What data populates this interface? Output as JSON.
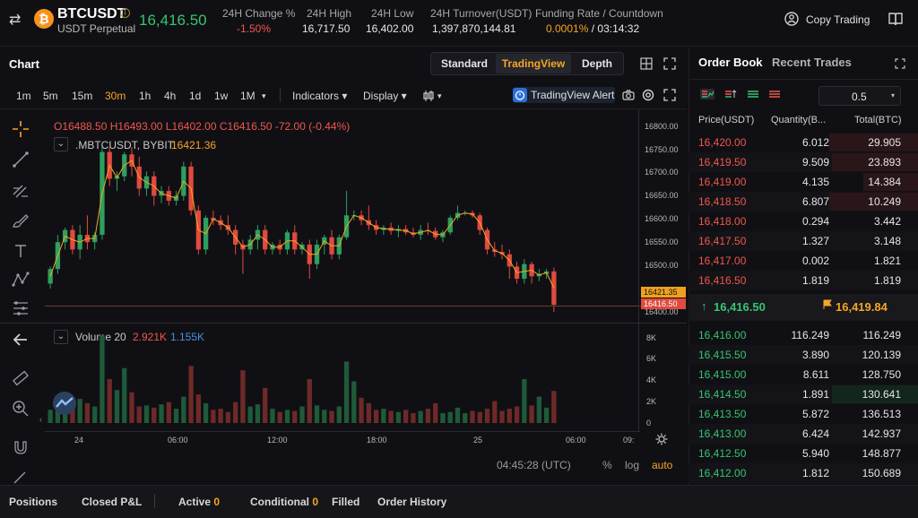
{
  "header": {
    "symbol": "BTCUSDT",
    "info_icon": "i",
    "subtitle": "USDT Perpetual",
    "last_price": "16,416.50",
    "stats": [
      {
        "label": "24H Change %",
        "value": "-1.50%"
      },
      {
        "label": "24H High",
        "value": "16,717.50"
      },
      {
        "label": "24H Low",
        "value": "16,402.00"
      },
      {
        "label": "24H Turnover(USDT)",
        "value": "1,397,870,144.81"
      }
    ],
    "funding_label": "Funding Rate / Countdown",
    "funding_rate": "0.0001%",
    "funding_sep": "/",
    "countdown": "03:14:32",
    "copy_trading": "Copy Trading",
    "coin_glyph": "₿"
  },
  "chart_header": {
    "title": "Chart",
    "views": [
      "Standard",
      "TradingView",
      "Depth"
    ],
    "active_view": "TradingView"
  },
  "toolbar": {
    "timeframes": [
      "1m",
      "5m",
      "15m",
      "30m",
      "1h",
      "4h",
      "1d",
      "1w",
      "1M"
    ],
    "active_timeframe": "30m",
    "timeframe_more": "▾",
    "indicators": "Indicators ▾",
    "display": "Display ▾",
    "chart_type_caret": "▾",
    "tv_alert": "TradingView Alert"
  },
  "legend": {
    "ohlc": "O16488.50  H16493.00  L16402.00  C16416.50  -72.00 (-0.44%)",
    "series_name": ".MBTCUSDT, BYBIT",
    "series_value": "16421.36",
    "volume_name": "Volume 20",
    "volume_v1": "2.921K",
    "volume_v2": "1.155K",
    "collapse_glyph": "⌄"
  },
  "price_axis": {
    "ticks": [
      "16800.00",
      "16750.00",
      "16700.00",
      "16650.00",
      "16600.00",
      "16550.00",
      "16500.00",
      "16400.00"
    ],
    "tag_index": "16421.35",
    "tag_last": "16416.50",
    "volume_ticks": [
      "8K",
      "6K",
      "4K",
      "2K",
      "0"
    ]
  },
  "time_axis": {
    "ticks": [
      "24",
      "06:00",
      "12:00",
      "18:00",
      "25",
      "06:00",
      "09:"
    ]
  },
  "chart_footer": {
    "clock": "04:45:28 (UTC)",
    "percent": "%",
    "log": "log",
    "auto": "auto"
  },
  "chart_data": {
    "type": "candlestick",
    "interval": "30m",
    "symbol": "BTCUSDT",
    "ylim": [
      16380,
      16810
    ],
    "x_ticks": [
      "24",
      "06:00",
      "12:00",
      "18:00",
      "25",
      "06:00",
      "09:"
    ],
    "candles": [
      [
        16460,
        16495,
        16450,
        16490
      ],
      [
        16490,
        16560,
        16480,
        16545
      ],
      [
        16545,
        16575,
        16530,
        16570
      ],
      [
        16570,
        16580,
        16520,
        16530
      ],
      [
        16530,
        16580,
        16510,
        16560
      ],
      [
        16560,
        16600,
        16530,
        16545
      ],
      [
        16545,
        16565,
        16530,
        16560
      ],
      [
        16560,
        16740,
        16550,
        16730
      ],
      [
        16730,
        16740,
        16660,
        16675
      ],
      [
        16675,
        16690,
        16650,
        16680
      ],
      [
        16680,
        16730,
        16670,
        16725
      ],
      [
        16725,
        16740,
        16680,
        16700
      ],
      [
        16700,
        16720,
        16640,
        16655
      ],
      [
        16655,
        16690,
        16640,
        16680
      ],
      [
        16680,
        16690,
        16620,
        16640
      ],
      [
        16640,
        16660,
        16625,
        16650
      ],
      [
        16650,
        16660,
        16620,
        16630
      ],
      [
        16630,
        16650,
        16620,
        16640
      ],
      [
        16640,
        16710,
        16630,
        16700
      ],
      [
        16700,
        16710,
        16600,
        16610
      ],
      [
        16610,
        16620,
        16520,
        16530
      ],
      [
        16530,
        16600,
        16520,
        16595
      ],
      [
        16595,
        16610,
        16580,
        16590
      ],
      [
        16590,
        16600,
        16570,
        16580
      ],
      [
        16580,
        16600,
        16560,
        16570
      ],
      [
        16570,
        16580,
        16520,
        16540
      ],
      [
        16540,
        16550,
        16480,
        16530
      ],
      [
        16530,
        16560,
        16520,
        16550
      ],
      [
        16550,
        16580,
        16530,
        16570
      ],
      [
        16570,
        16580,
        16520,
        16530
      ],
      [
        16530,
        16545,
        16520,
        16540
      ],
      [
        16540,
        16550,
        16520,
        16530
      ],
      [
        16530,
        16570,
        16520,
        16565
      ],
      [
        16565,
        16580,
        16520,
        16530
      ],
      [
        16530,
        16545,
        16520,
        16540
      ],
      [
        16540,
        16550,
        16470,
        16500
      ],
      [
        16500,
        16550,
        16490,
        16540
      ],
      [
        16540,
        16560,
        16520,
        16555
      ],
      [
        16555,
        16570,
        16510,
        16520
      ],
      [
        16520,
        16560,
        16510,
        16555
      ],
      [
        16555,
        16650,
        16550,
        16600
      ],
      [
        16600,
        16610,
        16590,
        16600
      ],
      [
        16600,
        16610,
        16580,
        16590
      ],
      [
        16590,
        16620,
        16570,
        16580
      ],
      [
        16580,
        16590,
        16560,
        16570
      ],
      [
        16570,
        16580,
        16560,
        16575
      ],
      [
        16575,
        16585,
        16560,
        16568
      ],
      [
        16568,
        16580,
        16555,
        16572
      ],
      [
        16572,
        16580,
        16560,
        16565
      ],
      [
        16565,
        16575,
        16555,
        16560
      ],
      [
        16560,
        16580,
        16550,
        16570
      ],
      [
        16570,
        16585,
        16560,
        16568
      ],
      [
        16568,
        16575,
        16550,
        16555
      ],
      [
        16555,
        16570,
        16545,
        16565
      ],
      [
        16565,
        16600,
        16560,
        16595
      ],
      [
        16595,
        16620,
        16590,
        16605
      ],
      [
        16605,
        16610,
        16600,
        16605
      ],
      [
        16605,
        16610,
        16595,
        16600
      ],
      [
        16600,
        16605,
        16560,
        16570
      ],
      [
        16570,
        16575,
        16520,
        16530
      ],
      [
        16530,
        16545,
        16515,
        16525
      ],
      [
        16525,
        16540,
        16510,
        16520
      ],
      [
        16520,
        16530,
        16470,
        16495
      ],
      [
        16495,
        16505,
        16460,
        16470
      ],
      [
        16470,
        16510,
        16460,
        16500
      ],
      [
        16500,
        16505,
        16460,
        16475
      ],
      [
        16475,
        16490,
        16465,
        16480
      ],
      [
        16480,
        16490,
        16470,
        16485
      ],
      [
        16485,
        16493,
        16402,
        16416.5
      ]
    ],
    "volume_ylim": [
      0,
      8000
    ],
    "volumes": [
      1200,
      2500,
      2000,
      1600,
      2200,
      1800,
      1500,
      8000,
      4000,
      3000,
      5000,
      2800,
      1500,
      1600,
      1400,
      1700,
      1900,
      1300,
      2400,
      5200,
      2600,
      1800,
      1200,
      1300,
      1000,
      1900,
      4800,
      1500,
      1700,
      3200,
      1300,
      1000,
      1200,
      1100,
      1500,
      4000,
      1600,
      1200,
      1100,
      1500,
      5600,
      3800,
      2300,
      1800,
      1200,
      1300,
      1100,
      1000,
      1200,
      900,
      1100,
      1300,
      1800,
      900,
      1000,
      1400,
      900,
      1100,
      1000,
      1300,
      2000,
      1100,
      1300,
      1500,
      4000,
      1600,
      2400,
      1400,
      2921
    ]
  },
  "order_book": {
    "tabs": [
      "Order Book",
      "Recent Trades"
    ],
    "active_tab": "Order Book",
    "precision": "0.5",
    "precision_caret": "▾",
    "columns": [
      "Price(USDT)",
      "Quantity(B...",
      "Total(BTC)"
    ],
    "asks": [
      {
        "price": "16,420.00",
        "qty": "6.012",
        "total": "29.905",
        "depth": 0.62
      },
      {
        "price": "16,419.50",
        "qty": "9.509",
        "total": "23.893",
        "depth": 0.6
      },
      {
        "price": "16,419.00",
        "qty": "4.135",
        "total": "14.384",
        "depth": 0.38
      },
      {
        "price": "16,418.50",
        "qty": "6.807",
        "total": "10.249",
        "depth": 0.62
      },
      {
        "price": "16,418.00",
        "qty": "0.294",
        "total": "3.442",
        "depth": 0.0
      },
      {
        "price": "16,417.50",
        "qty": "1.327",
        "total": "3.148",
        "depth": 0.0
      },
      {
        "price": "16,417.00",
        "qty": "0.002",
        "total": "1.821",
        "depth": 0.0
      },
      {
        "price": "16,416.50",
        "qty": "1.819",
        "total": "1.819",
        "depth": 0.0
      }
    ],
    "mid_arrow": "↑",
    "mid_last": "16,416.50",
    "mid_mark": "16,419.84",
    "bids": [
      {
        "price": "16,416.00",
        "qty": "116.249",
        "total": "116.249",
        "depth": 0.0
      },
      {
        "price": "16,415.50",
        "qty": "3.890",
        "total": "120.139",
        "depth": 0.0
      },
      {
        "price": "16,415.00",
        "qty": "8.611",
        "total": "128.750",
        "depth": 0.0
      },
      {
        "price": "16,414.50",
        "qty": "1.891",
        "total": "130.641",
        "depth": 0.6
      },
      {
        "price": "16,413.50",
        "qty": "5.872",
        "total": "136.513",
        "depth": 0.0
      },
      {
        "price": "16,413.00",
        "qty": "6.424",
        "total": "142.937",
        "depth": 0.0
      },
      {
        "price": "16,412.50",
        "qty": "5.940",
        "total": "148.877",
        "depth": 0.0
      },
      {
        "price": "16,412.00",
        "qty": "1.812",
        "total": "150.689",
        "depth": 0.0
      }
    ]
  },
  "bottom_tabs": [
    {
      "label": "Positions",
      "count": ""
    },
    {
      "label": "Closed P&L",
      "count": ""
    },
    {
      "label": "Active",
      "count": "0"
    },
    {
      "label": "Conditional",
      "count": "0"
    },
    {
      "label": "Filled",
      "count": ""
    },
    {
      "label": "Order History",
      "count": ""
    }
  ],
  "colors": {
    "up": "#35c572",
    "down": "#f0564c",
    "up_candle": "#2e9f5e",
    "down_candle": "#e04a3f",
    "accent": "#f5a623",
    "ask_depth": "#2a1618",
    "bid_depth": "#13261c"
  }
}
